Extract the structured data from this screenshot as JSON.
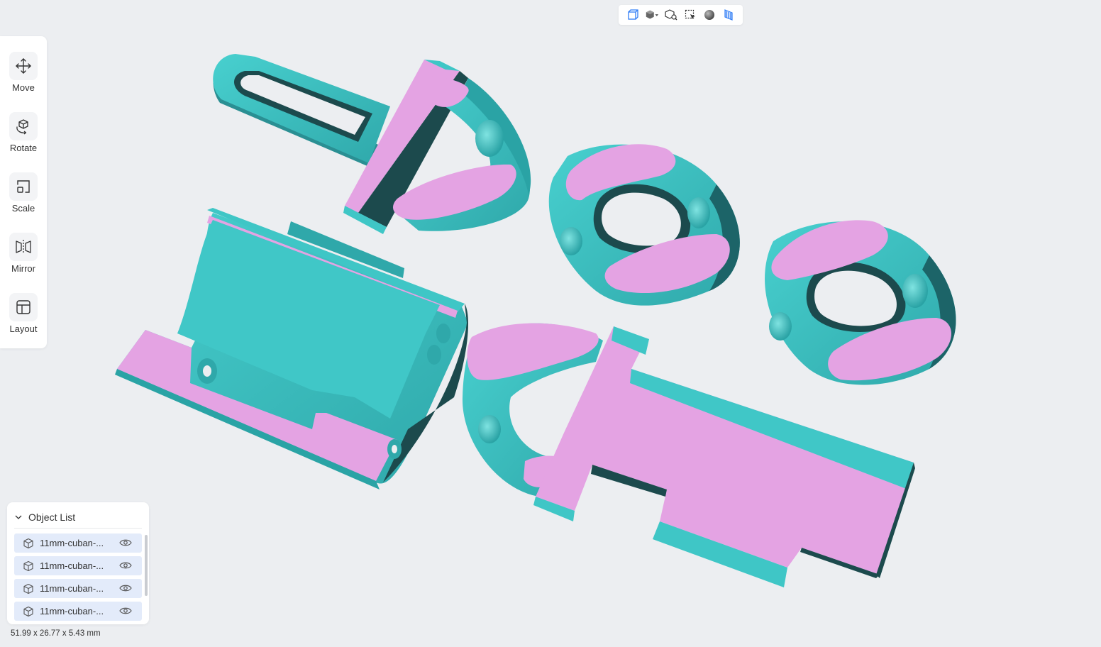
{
  "view_toolbar": {
    "icons": [
      "wireframe-view-icon",
      "view-cube-dropdown-icon",
      "zoom-to-fit-icon",
      "select-icon",
      "shaded-sphere-icon",
      "slice-view-icon"
    ]
  },
  "tools": [
    {
      "label": "Move",
      "icon": "move-icon"
    },
    {
      "label": "Rotate",
      "icon": "rotate-icon"
    },
    {
      "label": "Scale",
      "icon": "scale-icon"
    },
    {
      "label": "Mirror",
      "icon": "mirror-icon"
    },
    {
      "label": "Layout",
      "icon": "layout-icon"
    }
  ],
  "object_list": {
    "title": "Object List",
    "items": [
      {
        "name": "11mm-cuban-..."
      },
      {
        "name": "11mm-cuban-..."
      },
      {
        "name": "11mm-cuban-..."
      },
      {
        "name": "11mm-cuban-..."
      }
    ]
  },
  "dimensions": "51.99 x 26.77 x 5.43 mm",
  "colors": {
    "model_teal": "#3fc6c6",
    "model_dark": "#1c4a4d",
    "cut_face": "#e4a3e3",
    "accent_blue": "#2f7df6",
    "background": "#eceef1"
  }
}
